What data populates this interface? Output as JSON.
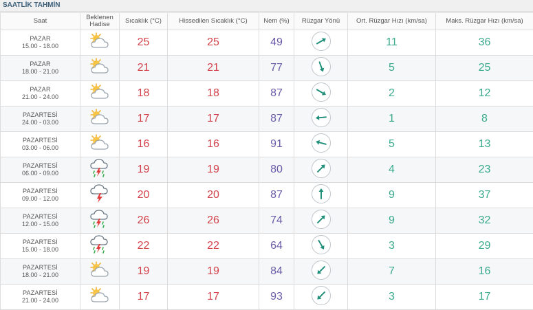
{
  "title": "SAATLİK TAHMİN",
  "headers": {
    "saat": "Saat",
    "hadise": "Beklenen Hadise",
    "sicaklik": "Sıcaklık (°C)",
    "hissedilen": "Hissedilen Sıcaklık (°C)",
    "nem": "Nem (%)",
    "ruzgar_yonu": "Rüzgar Yönü",
    "ort_ruzgar": "Ort. Rüzgar Hızı (km/sa)",
    "maks_ruzgar": "Maks. Rüzgar Hızı (km/sa)"
  },
  "rows": [
    {
      "day": "PAZAR",
      "time": "15.00 - 18.00",
      "icon": "sun-cloud-icon",
      "temp": "25",
      "feels": "25",
      "humidity": "49",
      "wind_dir_deg": 60,
      "wind_avg": "11",
      "wind_max": "36"
    },
    {
      "day": "PAZAR",
      "time": "18.00 - 21.00",
      "icon": "sun-cloud-icon",
      "temp": "21",
      "feels": "21",
      "humidity": "77",
      "wind_dir_deg": 160,
      "wind_avg": "5",
      "wind_max": "25"
    },
    {
      "day": "PAZAR",
      "time": "21.00 - 24.00",
      "icon": "sun-cloud-icon",
      "temp": "18",
      "feels": "18",
      "humidity": "87",
      "wind_dir_deg": 120,
      "wind_avg": "2",
      "wind_max": "12"
    },
    {
      "day": "PAZARTESİ",
      "time": "24.00 - 03.00",
      "icon": "sun-cloud-icon",
      "temp": "17",
      "feels": "17",
      "humidity": "87",
      "wind_dir_deg": 265,
      "wind_avg": "1",
      "wind_max": "8"
    },
    {
      "day": "PAZARTESİ",
      "time": "03.00 - 06.00",
      "icon": "sun-cloud-icon",
      "temp": "16",
      "feels": "16",
      "humidity": "91",
      "wind_dir_deg": 285,
      "wind_avg": "5",
      "wind_max": "13"
    },
    {
      "day": "PAZARTESİ",
      "time": "06.00 - 09.00",
      "icon": "thunder-rain-icon",
      "temp": "19",
      "feels": "19",
      "humidity": "80",
      "wind_dir_deg": 45,
      "wind_avg": "4",
      "wind_max": "23"
    },
    {
      "day": "PAZARTESİ",
      "time": "09.00 - 12.00",
      "icon": "thunder-icon",
      "temp": "20",
      "feels": "20",
      "humidity": "87",
      "wind_dir_deg": 0,
      "wind_avg": "9",
      "wind_max": "37"
    },
    {
      "day": "PAZARTESİ",
      "time": "12.00 - 15.00",
      "icon": "thunder-rain-icon",
      "temp": "26",
      "feels": "26",
      "humidity": "74",
      "wind_dir_deg": 45,
      "wind_avg": "9",
      "wind_max": "32"
    },
    {
      "day": "PAZARTESİ",
      "time": "15.00 - 18.00",
      "icon": "thunder-rain-icon",
      "temp": "22",
      "feels": "22",
      "humidity": "64",
      "wind_dir_deg": 150,
      "wind_avg": "3",
      "wind_max": "29"
    },
    {
      "day": "PAZARTESİ",
      "time": "18.00 - 21.00",
      "icon": "sun-cloud-icon",
      "temp": "19",
      "feels": "19",
      "humidity": "84",
      "wind_dir_deg": 225,
      "wind_avg": "7",
      "wind_max": "16"
    },
    {
      "day": "PAZARTESİ",
      "time": "21.00 - 24.00",
      "icon": "sun-cloud-icon",
      "temp": "17",
      "feels": "17",
      "humidity": "93",
      "wind_dir_deg": 225,
      "wind_avg": "3",
      "wind_max": "17"
    }
  ]
}
